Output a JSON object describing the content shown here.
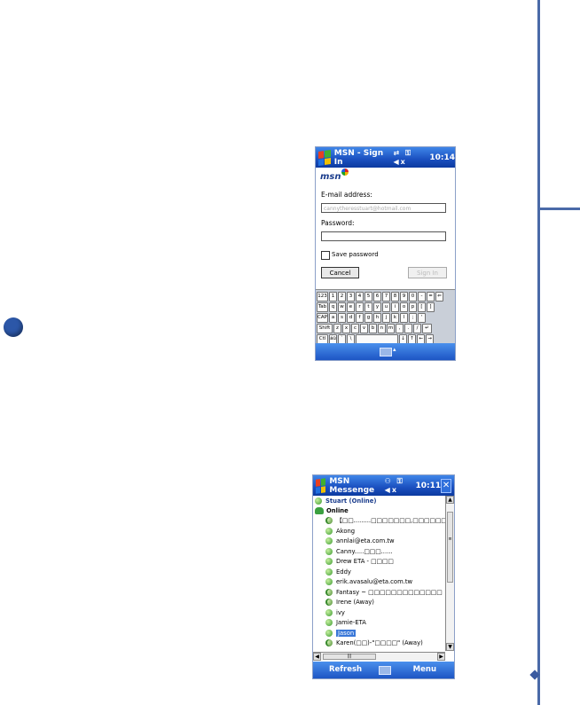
{
  "signin": {
    "title": "MSN - Sign In",
    "status_icons": "⇄ ⚿ ◀x",
    "time": "10:14",
    "logo": "msn",
    "email_label": "E-mail address:",
    "email_value": "cannytheresstuart@hotmail.com",
    "password_label": "Password:",
    "password_value": "",
    "save_password_label": "Save password",
    "cancel_label": "Cancel",
    "signin_label": "Sign In",
    "keyboard": {
      "row1": [
        "123",
        "1",
        "2",
        "3",
        "4",
        "5",
        "6",
        "7",
        "8",
        "9",
        "0",
        "-",
        "=",
        "⇐"
      ],
      "row2": [
        "Tab",
        "q",
        "w",
        "e",
        "r",
        "t",
        "y",
        "u",
        "i",
        "o",
        "p",
        "[",
        "]"
      ],
      "row3": [
        "CAP",
        "a",
        "s",
        "d",
        "f",
        "g",
        "h",
        "j",
        "k",
        "l",
        ";",
        "'"
      ],
      "row4": [
        "Shift",
        "z",
        "x",
        "c",
        "v",
        "b",
        "n",
        "m",
        ",",
        ".",
        "/",
        "↵"
      ],
      "row5": [
        "Ctl",
        "áü",
        "`",
        "\\",
        " ",
        "↓",
        "↑",
        "←",
        "→"
      ]
    }
  },
  "messenger": {
    "title": "MSN Messenge",
    "status_icons": "⚇ ⚿ ◀x",
    "time": "10:11",
    "close_label": "✕",
    "user": "Stuart (Online)",
    "group": "Online",
    "contacts": [
      "【□□.........□□□□□□□,□□□□□□",
      "Akong",
      "annlai@eta.com.tw",
      "Canny.....□□□......",
      "Drew ETA - □□□□",
      "Eddy",
      "erik.avasalu@eta.com.tw",
      "Fantasy ~ □□□□□□□□□□□□□",
      "Irene (Away)",
      "ivy",
      "Jamie-ETA",
      "Jason",
      "Karen(□□)-\"□□□□\" (Away)"
    ],
    "away_rows": [
      0,
      7,
      8,
      12
    ],
    "selected_index": 11,
    "refresh_label": "Refresh",
    "menu_label": "Menu"
  }
}
